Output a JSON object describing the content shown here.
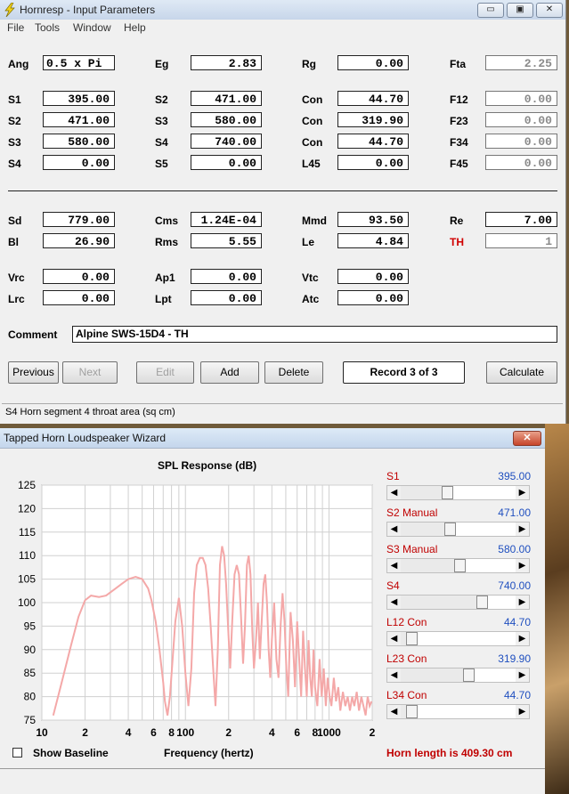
{
  "window1": {
    "title": "Hornresp - Input Parameters",
    "menu": [
      "File",
      "Tools",
      "Window",
      "Help"
    ],
    "controls": {
      "minimize": "▭",
      "restore": "▣",
      "close": "✕"
    }
  },
  "params": {
    "ang": {
      "label": "Ang",
      "value": "0.5 x Pi"
    },
    "eg": {
      "label": "Eg",
      "value": "2.83"
    },
    "rg": {
      "label": "Rg",
      "value": "0.00"
    },
    "fta": {
      "label": "Fta",
      "value": "2.25"
    },
    "s1": {
      "label": "S1",
      "value": "395.00"
    },
    "s2a": {
      "label": "S2",
      "value": "471.00"
    },
    "con1": {
      "label": "Con",
      "value": "44.70"
    },
    "f12": {
      "label": "F12",
      "value": "0.00"
    },
    "s2b": {
      "label": "S2",
      "value": "471.00"
    },
    "s3a": {
      "label": "S3",
      "value": "580.00"
    },
    "con2": {
      "label": "Con",
      "value": "319.90"
    },
    "f23": {
      "label": "F23",
      "value": "0.00"
    },
    "s3b": {
      "label": "S3",
      "value": "580.00"
    },
    "s4a": {
      "label": "S4",
      "value": "740.00"
    },
    "con3": {
      "label": "Con",
      "value": "44.70"
    },
    "f34": {
      "label": "F34",
      "value": "0.00"
    },
    "s4b": {
      "label": "S4",
      "value": "0.00"
    },
    "s5": {
      "label": "S5",
      "value": "0.00"
    },
    "l45": {
      "label": "L45",
      "value": "0.00"
    },
    "f45": {
      "label": "F45",
      "value": "0.00"
    },
    "sd": {
      "label": "Sd",
      "value": "779.00"
    },
    "cms": {
      "label": "Cms",
      "value": "1.24E-04"
    },
    "mmd": {
      "label": "Mmd",
      "value": "93.50"
    },
    "re": {
      "label": "Re",
      "value": "7.00"
    },
    "bl": {
      "label": "Bl",
      "value": "26.90"
    },
    "rms": {
      "label": "Rms",
      "value": "5.55"
    },
    "le": {
      "label": "Le",
      "value": "4.84"
    },
    "th": {
      "label": "TH",
      "value": "1"
    },
    "vrc": {
      "label": "Vrc",
      "value": "0.00"
    },
    "ap1": {
      "label": "Ap1",
      "value": "0.00"
    },
    "vtc": {
      "label": "Vtc",
      "value": "0.00"
    },
    "lrc": {
      "label": "Lrc",
      "value": "0.00"
    },
    "lpt": {
      "label": "Lpt",
      "value": "0.00"
    },
    "atc": {
      "label": "Atc",
      "value": "0.00"
    }
  },
  "comment": {
    "label": "Comment",
    "value": "Alpine SWS-15D4 - TH"
  },
  "buttons": {
    "previous": "Previous",
    "next": "Next",
    "edit": "Edit",
    "add": "Add",
    "delete": "Delete",
    "record": "Record 3 of 3",
    "calculate": "Calculate"
  },
  "status": "S4   Horn segment 4 throat area  (sq cm)",
  "window2": {
    "title": "Tapped Horn Loudspeaker Wizard",
    "close": "✕"
  },
  "chart_data": {
    "type": "line",
    "title": "SPL Response (dB)",
    "xlabel": "Frequency (hertz)",
    "ylabel": "",
    "x_scale": "log",
    "xlim": [
      10,
      2000
    ],
    "ylim": [
      75,
      125
    ],
    "yticks": [
      75,
      80,
      85,
      90,
      95,
      100,
      105,
      110,
      115,
      120,
      125
    ],
    "xtick_labels": [
      {
        "x": 10,
        "label": "10"
      },
      {
        "x": 20,
        "label": "2"
      },
      {
        "x": 40,
        "label": "4"
      },
      {
        "x": 60,
        "label": "6"
      },
      {
        "x": 80,
        "label": "8"
      },
      {
        "x": 100,
        "label": "100"
      },
      {
        "x": 200,
        "label": "2"
      },
      {
        "x": 400,
        "label": "4"
      },
      {
        "x": 600,
        "label": "6"
      },
      {
        "x": 800,
        "label": "8"
      },
      {
        "x": 1000,
        "label": "1000"
      },
      {
        "x": 2000,
        "label": "2"
      }
    ],
    "grid": true,
    "color": "#f4a8a8",
    "series": [
      {
        "x": [
          12,
          14,
          16,
          18,
          20,
          22,
          25,
          28,
          32,
          36,
          40,
          45,
          50,
          55,
          58,
          62,
          66,
          70,
          72,
          75,
          78,
          81,
          85,
          90,
          95,
          100,
          105,
          110,
          115,
          120,
          126,
          132,
          138,
          144,
          150,
          156,
          162,
          168,
          174,
          180,
          186,
          192,
          198,
          205,
          212,
          220,
          228,
          236,
          244,
          252,
          260,
          268,
          276,
          284,
          292,
          300,
          310,
          320,
          330,
          340,
          350,
          360,
          370,
          380,
          390,
          400,
          415,
          430,
          445,
          460,
          475,
          490,
          505,
          520,
          540,
          560,
          580,
          600,
          620,
          640,
          660,
          680,
          700,
          720,
          740,
          760,
          780,
          800,
          830,
          860,
          890,
          920,
          950,
          980,
          1010,
          1040,
          1080,
          1120,
          1160,
          1200,
          1250,
          1300,
          1350,
          1400,
          1450,
          1500,
          1560,
          1620,
          1680,
          1740,
          1800,
          1860,
          1920,
          1980
        ],
        "y": [
          76,
          84,
          91,
          97,
          100.5,
          101.5,
          101.2,
          101.5,
          102.8,
          104,
          105,
          105.5,
          105,
          103,
          100.5,
          96,
          90,
          83,
          79,
          76,
          80,
          87,
          96,
          101,
          95,
          85,
          78,
          86,
          102,
          108,
          109.5,
          109.5,
          108,
          103,
          95,
          86,
          78,
          90,
          108,
          112,
          110,
          104,
          95,
          86,
          96,
          106,
          108,
          106,
          97,
          87,
          95,
          108,
          110,
          106,
          94,
          86,
          92,
          100,
          88,
          96,
          104,
          106,
          100,
          90,
          84,
          92,
          100,
          88,
          84,
          95,
          102,
          96,
          86,
          80,
          98,
          92,
          82,
          96,
          88,
          80,
          94,
          86,
          80,
          92,
          84,
          80,
          90,
          82,
          78,
          88,
          80,
          86,
          78,
          84,
          80,
          78,
          84,
          79,
          82,
          77,
          81,
          78,
          80,
          77,
          80,
          78,
          81,
          77,
          80,
          78,
          76,
          80,
          78,
          79
        ]
      }
    ]
  },
  "sliders": [
    {
      "label": "S1",
      "value": "395.00",
      "position": 0.4
    },
    {
      "label": "S2  Manual",
      "value": "471.00",
      "position": 0.42
    },
    {
      "label": "S3  Manual",
      "value": "580.00",
      "position": 0.52
    },
    {
      "label": "S4",
      "value": "740.00",
      "position": 0.73
    },
    {
      "label": "L12  Con",
      "value": "44.70",
      "position": 0.05
    },
    {
      "label": "L23  Con",
      "value": "319.90",
      "position": 0.6
    },
    {
      "label": "L34  Con",
      "value": "44.70",
      "position": 0.05
    }
  ],
  "baseline": {
    "label": "Show Baseline",
    "checked": false
  },
  "horn_length": "Horn length is 409.30 cm"
}
